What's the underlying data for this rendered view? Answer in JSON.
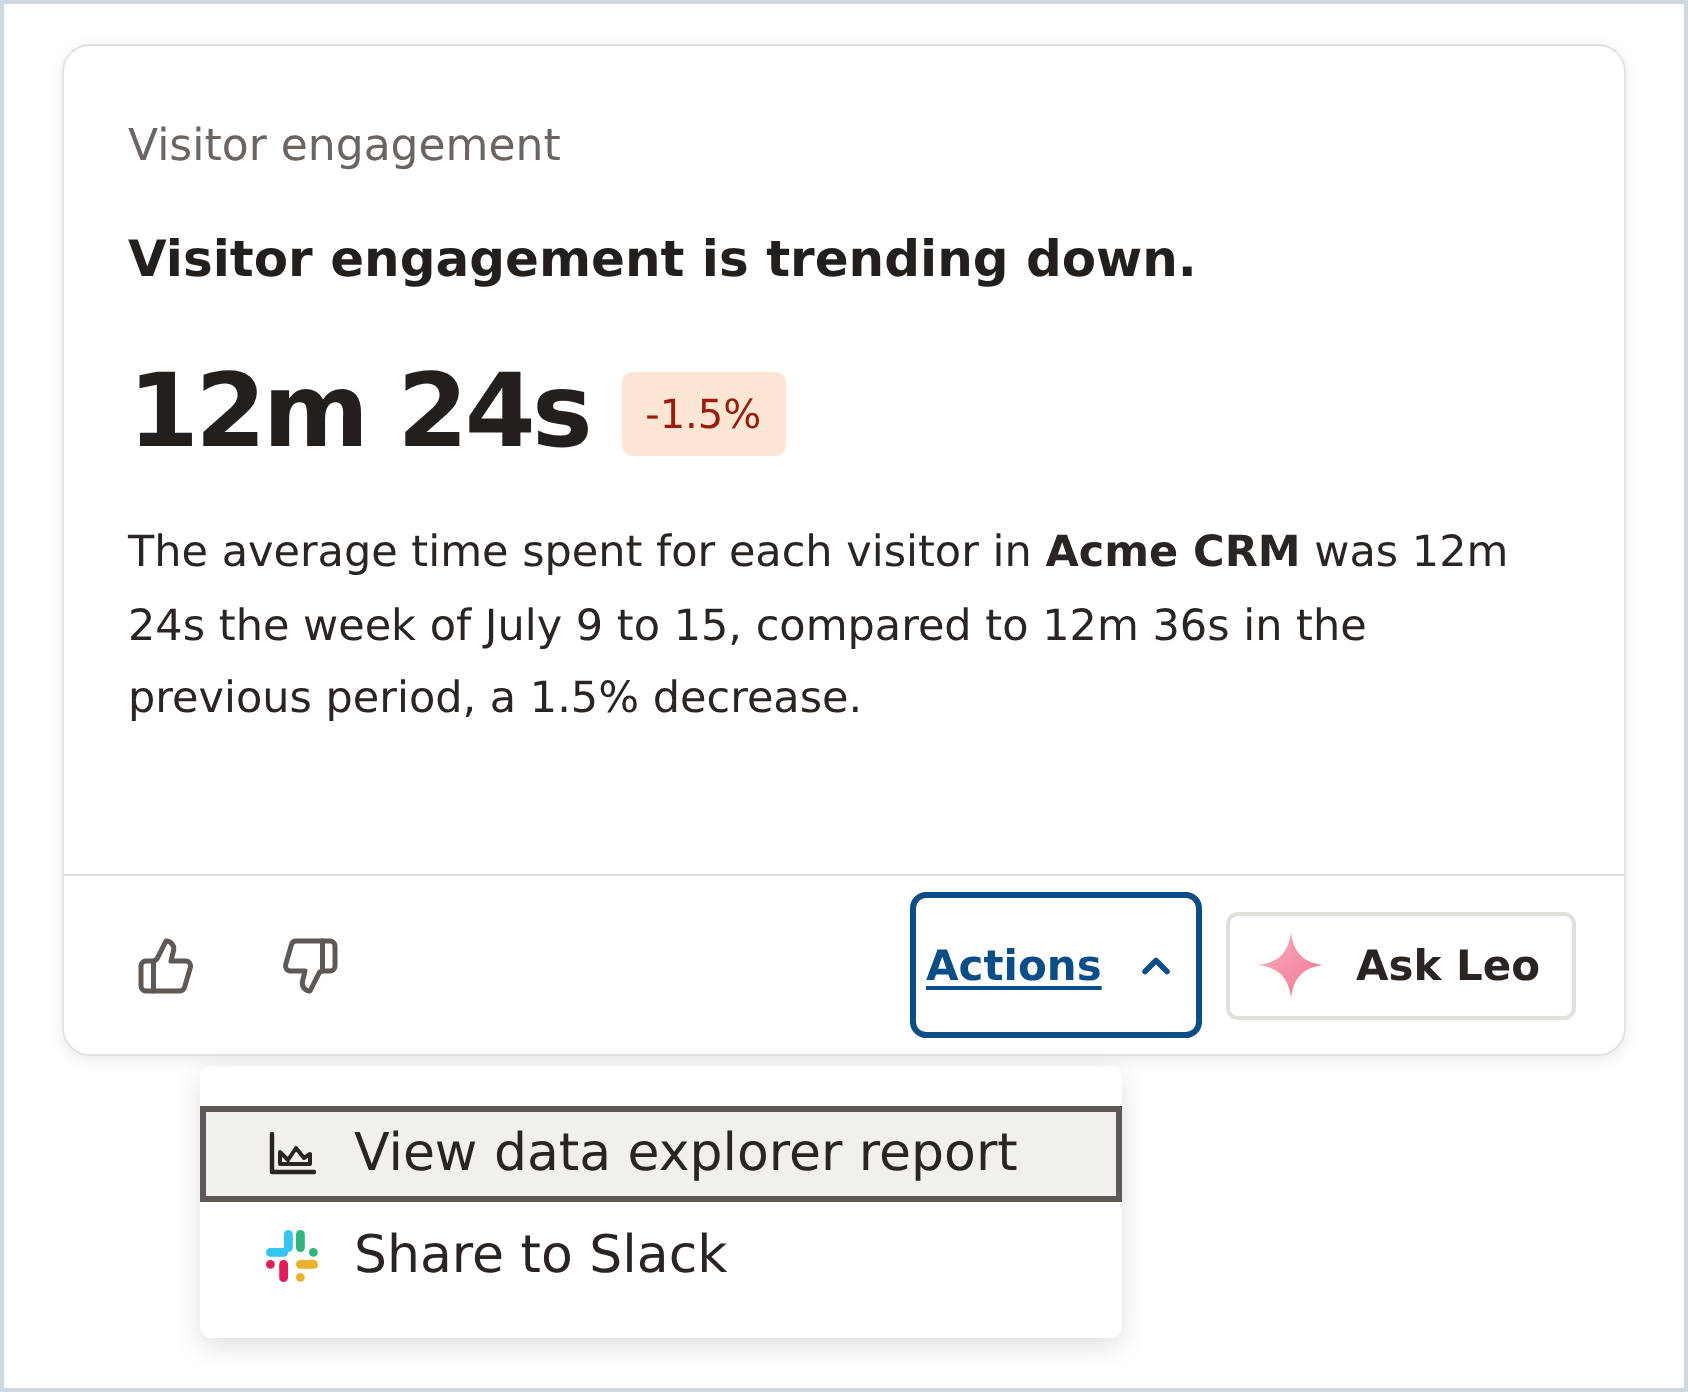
{
  "card": {
    "eyebrow": "Visitor engagement",
    "headline": "Visitor engagement is trending down.",
    "metric": {
      "value": "12m 24s",
      "change": "-1.5%"
    },
    "summary": "The average time spent for each visitor in **Acme CRM** was 12m 24s the week of July 9 to 15, compared to 12m 36s in the previous period, a 1.5% decrease.",
    "footer": {
      "feedback": [
        {
          "kind": "like"
        },
        {
          "kind": "dislike"
        }
      ],
      "actions": {
        "label": "Actions",
        "expanded": true,
        "focused": true
      },
      "ask": {
        "label": "Ask Leo"
      }
    }
  },
  "menu": {
    "items": [
      {
        "label": "View data explorer report",
        "kind": "chart",
        "selected": true
      },
      {
        "label": "Share to Slack",
        "kind": "slack",
        "selected": false
      }
    ]
  }
}
